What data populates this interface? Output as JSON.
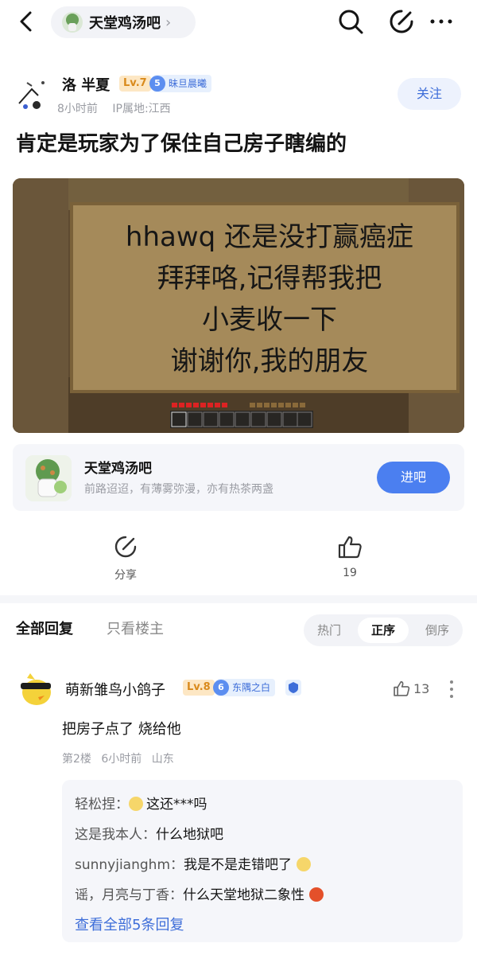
{
  "nav": {
    "forum_name": "天堂鸡汤吧",
    "chevron": "›",
    "icons": [
      "back-icon",
      "search-icon",
      "edit-icon",
      "more-icon"
    ]
  },
  "post": {
    "author": "洛 半夏",
    "level": "Lv.7",
    "medal_level": "5",
    "medal_name": "昧旦晨曦",
    "time": "8小时前",
    "ip": "IP属地:江西",
    "follow_label": "关注",
    "title": "肯定是玩家为了保住自己房子瞎编的",
    "image_text": [
      "hhawq 还是没打赢癌症",
      "拜拜咯,记得帮我把",
      "小麦收一下",
      "谢谢你,我的朋友"
    ]
  },
  "forum_card": {
    "name": "天堂鸡汤吧",
    "desc": "前路迢迢，有薄雾弥漫，亦有热茶两盏",
    "enter_label": "进吧"
  },
  "actions": {
    "share_label": "分享",
    "like_count": "19"
  },
  "replies": {
    "tab_all": "全部回复",
    "tab_owner": "只看楼主",
    "sort_hot": "热门",
    "sort_asc": "正序",
    "sort_desc": "倒序"
  },
  "comment": {
    "name": "萌新雏鸟小鸽子",
    "level": "Lv.8",
    "medal_level": "6",
    "medal_name": "东隅之白",
    "likes": "13",
    "body": "把房子点了 烧给他",
    "floor": "第2楼",
    "time": "6小时前",
    "location": "山东",
    "subreplies": [
      {
        "who": "轻松捏：",
        "text": "这还***吗"
      },
      {
        "who": "这是我本人：",
        "text": "什么地狱吧"
      },
      {
        "who": "sunnyjianghm：",
        "text": "我是不是走错吧了"
      },
      {
        "who": "谣，月亮与丁香：",
        "text": "什么天堂地狱二象性"
      }
    ],
    "view_all": "查看全部5条回复"
  },
  "colors": {
    "accent": "#4b7ff0",
    "link": "#3e6ed9",
    "level_bg": "#fde7c4",
    "level_fg": "#d98a1c"
  }
}
